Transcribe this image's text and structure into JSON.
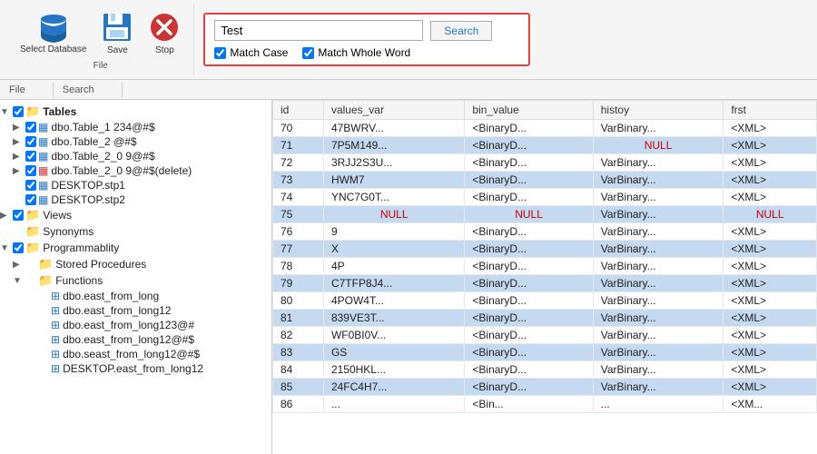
{
  "toolbar": {
    "file_label": "File",
    "search_label": "Search",
    "select_db_label": "Select\nDatabase",
    "save_label": "Save",
    "stop_label": "Stop",
    "search_input_value": "Test",
    "search_btn_label": "Search",
    "match_case_label": "Match Case",
    "match_whole_word_label": "Match Whole Word",
    "match_case_checked": true,
    "match_whole_word_checked": true
  },
  "tree": {
    "items": [
      {
        "id": "tables-root",
        "indent": 0,
        "arrow": "▼",
        "checkbox": true,
        "icon": "📁",
        "icon_class": "icon-tables",
        "label": "Tables",
        "bold": true
      },
      {
        "id": "table1",
        "indent": 1,
        "arrow": "▶",
        "checkbox": true,
        "icon": "▦",
        "icon_class": "icon-tables",
        "label": "dbo.Table_1 234@#$",
        "bold": false
      },
      {
        "id": "table2",
        "indent": 1,
        "arrow": "▶",
        "checkbox": true,
        "icon": "▦",
        "icon_class": "icon-tables",
        "label": "dbo.Table_2 @#$",
        "bold": false
      },
      {
        "id": "table3",
        "indent": 1,
        "arrow": "▶",
        "checkbox": true,
        "icon": "▦",
        "icon_class": "icon-tables",
        "label": "dbo.Table_2_0 9@#$",
        "bold": false
      },
      {
        "id": "table4",
        "indent": 1,
        "arrow": "▶",
        "checkbox": true,
        "icon": "▦",
        "icon_class": "icon-deleted",
        "label": "dbo.Table_2_0 9@#$(delete)",
        "bold": false
      },
      {
        "id": "table5",
        "indent": 1,
        "arrow": "",
        "checkbox": true,
        "icon": "▦",
        "icon_class": "icon-tables",
        "label": "DESKTOP.stp1",
        "bold": false
      },
      {
        "id": "table6",
        "indent": 1,
        "arrow": "",
        "checkbox": true,
        "icon": "▦",
        "icon_class": "icon-tables",
        "label": "DESKTOP.stp2",
        "bold": false
      },
      {
        "id": "views-root",
        "indent": 0,
        "arrow": "▶",
        "checkbox": true,
        "icon": "📁",
        "icon_class": "icon-views",
        "label": "Views",
        "bold": false
      },
      {
        "id": "syn-root",
        "indent": 0,
        "arrow": "",
        "checkbox": false,
        "icon": "📁",
        "icon_class": "icon-syn",
        "label": "Synonyms",
        "bold": false
      },
      {
        "id": "prog-root",
        "indent": 0,
        "arrow": "▼",
        "checkbox": true,
        "icon": "📁",
        "icon_class": "icon-prog",
        "label": "Programmablity",
        "bold": false
      },
      {
        "id": "sp-root",
        "indent": 1,
        "arrow": "▶",
        "checkbox": false,
        "icon": "📁",
        "icon_class": "icon-sp",
        "label": "Stored Procedures",
        "bold": false
      },
      {
        "id": "fn-root",
        "indent": 1,
        "arrow": "▼",
        "checkbox": false,
        "icon": "📁",
        "icon_class": "icon-fn",
        "label": "Functions",
        "bold": false
      },
      {
        "id": "fn1",
        "indent": 2,
        "arrow": "",
        "checkbox": false,
        "icon": "⊞",
        "icon_class": "icon-func-item",
        "label": "dbo.east_from_long",
        "bold": false
      },
      {
        "id": "fn2",
        "indent": 2,
        "arrow": "",
        "checkbox": false,
        "icon": "⊞",
        "icon_class": "icon-func-item",
        "label": "dbo.east_from_long12",
        "bold": false
      },
      {
        "id": "fn3",
        "indent": 2,
        "arrow": "",
        "checkbox": false,
        "icon": "⊞",
        "icon_class": "icon-func-item",
        "label": "dbo.east_from_long123@#",
        "bold": false
      },
      {
        "id": "fn4",
        "indent": 2,
        "arrow": "",
        "checkbox": false,
        "icon": "⊞",
        "icon_class": "icon-func-item",
        "label": "dbo.east_from_long12@#$",
        "bold": false
      },
      {
        "id": "fn5",
        "indent": 2,
        "arrow": "",
        "checkbox": false,
        "icon": "⊞",
        "icon_class": "icon-func-item",
        "label": "dbo.seast_from_long12@#$",
        "bold": false
      },
      {
        "id": "fn6",
        "indent": 2,
        "arrow": "",
        "checkbox": false,
        "icon": "⊞",
        "icon_class": "icon-func-item",
        "label": "DESKTOP.east_from_long12",
        "bold": false
      }
    ]
  },
  "table": {
    "columns": [
      "id",
      "values_var",
      "bin_value",
      "histoy",
      "frst"
    ],
    "rows": [
      {
        "id": "70",
        "values_var": "47BWRV...",
        "bin_value": "<BinaryD...",
        "histoy": "VarBinary...",
        "frst": "<XML>",
        "highlight": false
      },
      {
        "id": "71",
        "values_var": "7P5M149...",
        "bin_value": "<BinaryD...",
        "histoy": "NULL",
        "frst": "<XML>",
        "highlight": true
      },
      {
        "id": "72",
        "values_var": "3RJJ2S3U...",
        "bin_value": "<BinaryD...",
        "histoy": "VarBinary...",
        "frst": "<XML>",
        "highlight": false
      },
      {
        "id": "73",
        "values_var": "HWM7",
        "bin_value": "<BinaryD...",
        "histoy": "VarBinary...",
        "frst": "<XML>",
        "highlight": true
      },
      {
        "id": "74",
        "values_var": "YNC7G0T...",
        "bin_value": "<BinaryD...",
        "histoy": "VarBinary...",
        "frst": "<XML>",
        "highlight": false
      },
      {
        "id": "75",
        "values_var": "NULL",
        "bin_value": "NULL",
        "histoy": "VarBinary...",
        "frst": "NULL",
        "highlight": true,
        "null_row": true
      },
      {
        "id": "76",
        "values_var": "9",
        "bin_value": "<BinaryD...",
        "histoy": "VarBinary...",
        "frst": "<XML>",
        "highlight": false
      },
      {
        "id": "77",
        "values_var": "X",
        "bin_value": "<BinaryD...",
        "histoy": "VarBinary...",
        "frst": "<XML>",
        "highlight": true
      },
      {
        "id": "78",
        "values_var": "4P",
        "bin_value": "<BinaryD...",
        "histoy": "VarBinary...",
        "frst": "<XML>",
        "highlight": false
      },
      {
        "id": "79",
        "values_var": "C7TFP8J4...",
        "bin_value": "<BinaryD...",
        "histoy": "VarBinary...",
        "frst": "<XML>",
        "highlight": true
      },
      {
        "id": "80",
        "values_var": "4POW4T...",
        "bin_value": "<BinaryD...",
        "histoy": "VarBinary...",
        "frst": "<XML>",
        "highlight": false
      },
      {
        "id": "81",
        "values_var": "839VE3T...",
        "bin_value": "<BinaryD...",
        "histoy": "VarBinary...",
        "frst": "<XML>",
        "highlight": true
      },
      {
        "id": "82",
        "values_var": "WF0BI0V...",
        "bin_value": "<BinaryD...",
        "histoy": "VarBinary...",
        "frst": "<XML>",
        "highlight": false
      },
      {
        "id": "83",
        "values_var": "GS",
        "bin_value": "<BinaryD...",
        "histoy": "VarBinary...",
        "frst": "<XML>",
        "highlight": true
      },
      {
        "id": "84",
        "values_var": "2150HKL...",
        "bin_value": "<BinaryD...",
        "histoy": "VarBinary...",
        "frst": "<XML>",
        "highlight": false
      },
      {
        "id": "85",
        "values_var": "24FC4H7...",
        "bin_value": "<BinaryD...",
        "histoy": "VarBinary...",
        "frst": "<XML>",
        "highlight": true
      },
      {
        "id": "86",
        "values_var": "...",
        "bin_value": "<Bin...",
        "histoy": "...",
        "frst": "<XM...",
        "highlight": false
      }
    ]
  }
}
